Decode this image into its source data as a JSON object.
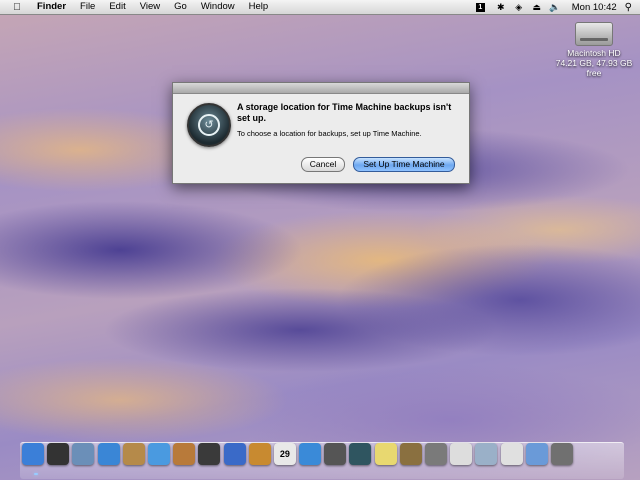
{
  "menubar": {
    "app_name": "Finder",
    "menus": [
      "File",
      "Edit",
      "View",
      "Go",
      "Window",
      "Help"
    ],
    "clock": "Mon 10:42",
    "input_badge": "1"
  },
  "desktop": {
    "drive_name": "Macintosh HD",
    "drive_info": "74.21 GB, 47.93 GB free"
  },
  "dialog": {
    "title": "A storage location for Time Machine backups isn't set up.",
    "message": "To choose a location for backups, set up Time Machine.",
    "cancel_label": "Cancel",
    "confirm_label": "Set Up Time Machine"
  },
  "dock": {
    "calendar_day": "29",
    "items": [
      {
        "name": "finder-icon",
        "color": "#3b7fd8"
      },
      {
        "name": "dashboard-icon",
        "color": "#333333"
      },
      {
        "name": "mail-icon",
        "color": "#6b8fb8"
      },
      {
        "name": "safari-icon",
        "color": "#3a86d6"
      },
      {
        "name": "address-book-icon",
        "color": "#b58a4a"
      },
      {
        "name": "itunes-icon",
        "color": "#4a9ae0"
      },
      {
        "name": "iphoto-icon",
        "color": "#b87a3a"
      },
      {
        "name": "imovie-icon",
        "color": "#3a3a3a"
      },
      {
        "name": "idvd-icon",
        "color": "#3a6ac8"
      },
      {
        "name": "garageband-icon",
        "color": "#c88a30"
      },
      {
        "name": "ical-icon",
        "color": "#e8e8e8"
      },
      {
        "name": "quicktime-icon",
        "color": "#3a8ad8"
      },
      {
        "name": "photo-booth-icon",
        "color": "#555555"
      },
      {
        "name": "time-machine-icon",
        "color": "#2f5560"
      },
      {
        "name": "stickies-icon",
        "color": "#e8d870"
      },
      {
        "name": "automator-icon",
        "color": "#8a7040"
      },
      {
        "name": "preview-icon",
        "color": "#7a7a7a"
      },
      {
        "name": "textedit-icon",
        "color": "#dddddd"
      },
      {
        "name": "downloads-stack-icon",
        "color": "#9ab0c8"
      },
      {
        "name": "documents-stack-icon",
        "color": "#e0e0e0"
      },
      {
        "name": "applications-folder-icon",
        "color": "#6a9ad8"
      },
      {
        "name": "trash-icon",
        "color": "#707070"
      }
    ]
  }
}
